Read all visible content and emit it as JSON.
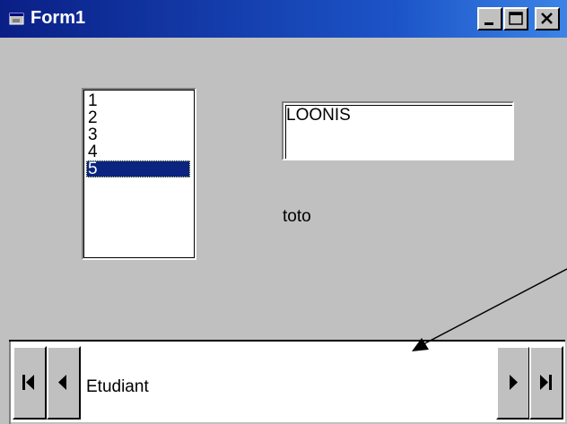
{
  "window": {
    "title": "Form1",
    "icons": {
      "app": "form-icon",
      "minimize": "minimize-icon",
      "maximize": "maximize-icon",
      "close": "close-icon"
    }
  },
  "listbox": {
    "items": [
      "1",
      "2",
      "3",
      "4",
      "5"
    ],
    "selected": "5"
  },
  "textbox": {
    "value": "LOONIS"
  },
  "label": {
    "text": "toto"
  },
  "data_control": {
    "caption": "Etudiant",
    "icons": {
      "first": "move-first-icon",
      "prev": "move-previous-icon",
      "next": "move-next-icon",
      "last": "move-last-icon"
    }
  },
  "colors": {
    "titlebar_start": "#0a1f86",
    "titlebar_end": "#3b84e6",
    "face": "#c0c0c0",
    "selection": "#0a2480"
  }
}
